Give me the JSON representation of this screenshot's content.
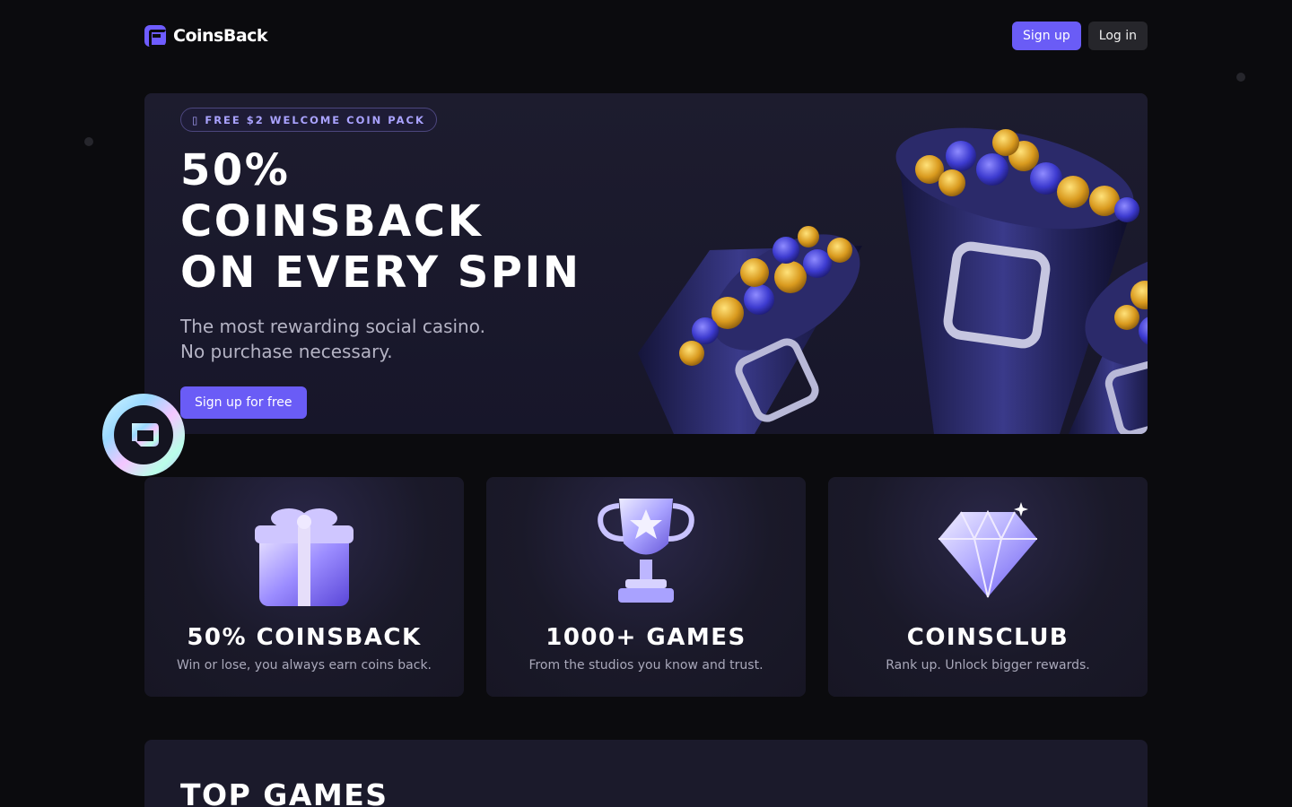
{
  "header": {
    "brand": "CoinsBack",
    "signup_label": "Sign up",
    "login_label": "Log in"
  },
  "hero": {
    "badge_icon": "gift-icon",
    "badge_text": "FREE $2 WELCOME COIN PACK",
    "title_lines": [
      "50%",
      "COINSBACK",
      "ON EVERY SPIN"
    ],
    "subtitle_lines": [
      "The most rewarding social casino.",
      "No purchase necessary."
    ],
    "cta_label": "Sign up for free"
  },
  "features": [
    {
      "icon": "gift-icon",
      "title": "50% COINSBACK",
      "desc": "Win or lose, you always earn coins back."
    },
    {
      "icon": "trophy-icon",
      "title": "1000+ GAMES",
      "desc": "From the studios you know and trust."
    },
    {
      "icon": "diamond-icon",
      "title": "COINSCLUB",
      "desc": "Rank up. Unlock bigger rewards."
    }
  ],
  "top_games": {
    "title": "TOP GAMES"
  },
  "colors": {
    "accent": "#6a5cf6",
    "background": "#0b0b0e",
    "card": "#1b1a2b",
    "coin_gold": "#e0a82e",
    "coin_blue": "#3d3bd0"
  }
}
